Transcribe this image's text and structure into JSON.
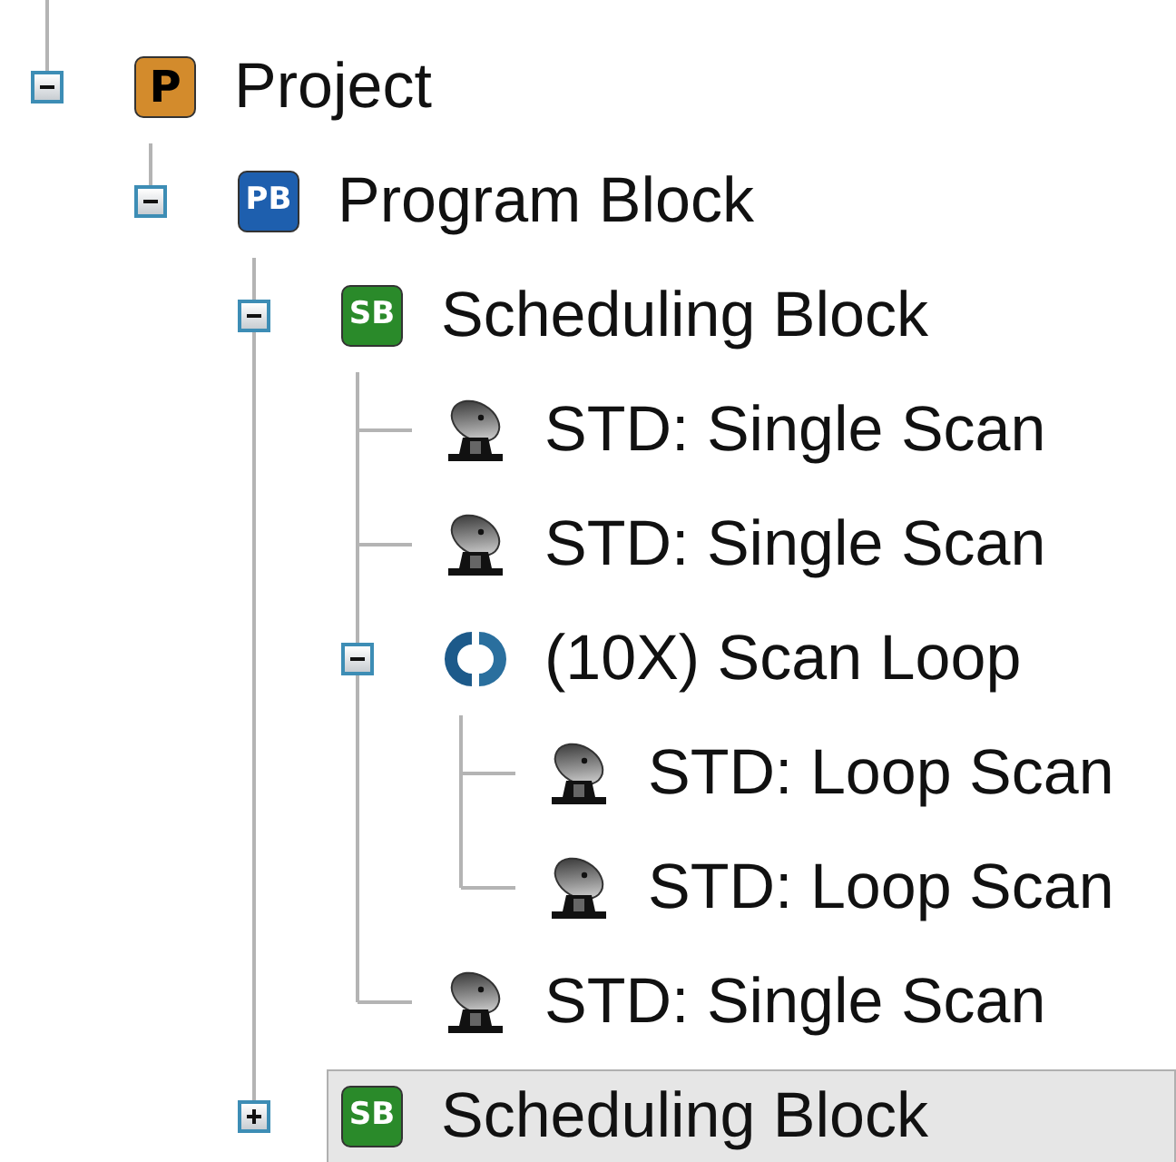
{
  "tree": [
    {
      "kind": "project",
      "badge": "P",
      "label": "Project",
      "expanded": true,
      "selected": false,
      "children": [
        {
          "kind": "program",
          "badge": "PB",
          "label": "Program Block",
          "expanded": true,
          "selected": false,
          "children": [
            {
              "kind": "scheduling",
              "badge": "SB",
              "label": "Scheduling Block",
              "expanded": true,
              "selected": false,
              "children": [
                {
                  "kind": "scan",
                  "label": "STD: Single Scan",
                  "selected": false
                },
                {
                  "kind": "scan",
                  "label": "STD: Single Scan",
                  "selected": false
                },
                {
                  "kind": "loop",
                  "label": "(10X) Scan Loop",
                  "expanded": true,
                  "selected": false,
                  "children": [
                    {
                      "kind": "scan",
                      "label": "STD: Loop Scan",
                      "selected": false
                    },
                    {
                      "kind": "scan",
                      "label": "STD: Loop Scan",
                      "selected": false
                    }
                  ]
                },
                {
                  "kind": "scan",
                  "label": "STD: Single Scan",
                  "selected": false
                }
              ]
            },
            {
              "kind": "scheduling",
              "badge": "SB",
              "label": "Scheduling Block",
              "expanded": false,
              "selected": true
            }
          ]
        }
      ]
    }
  ]
}
